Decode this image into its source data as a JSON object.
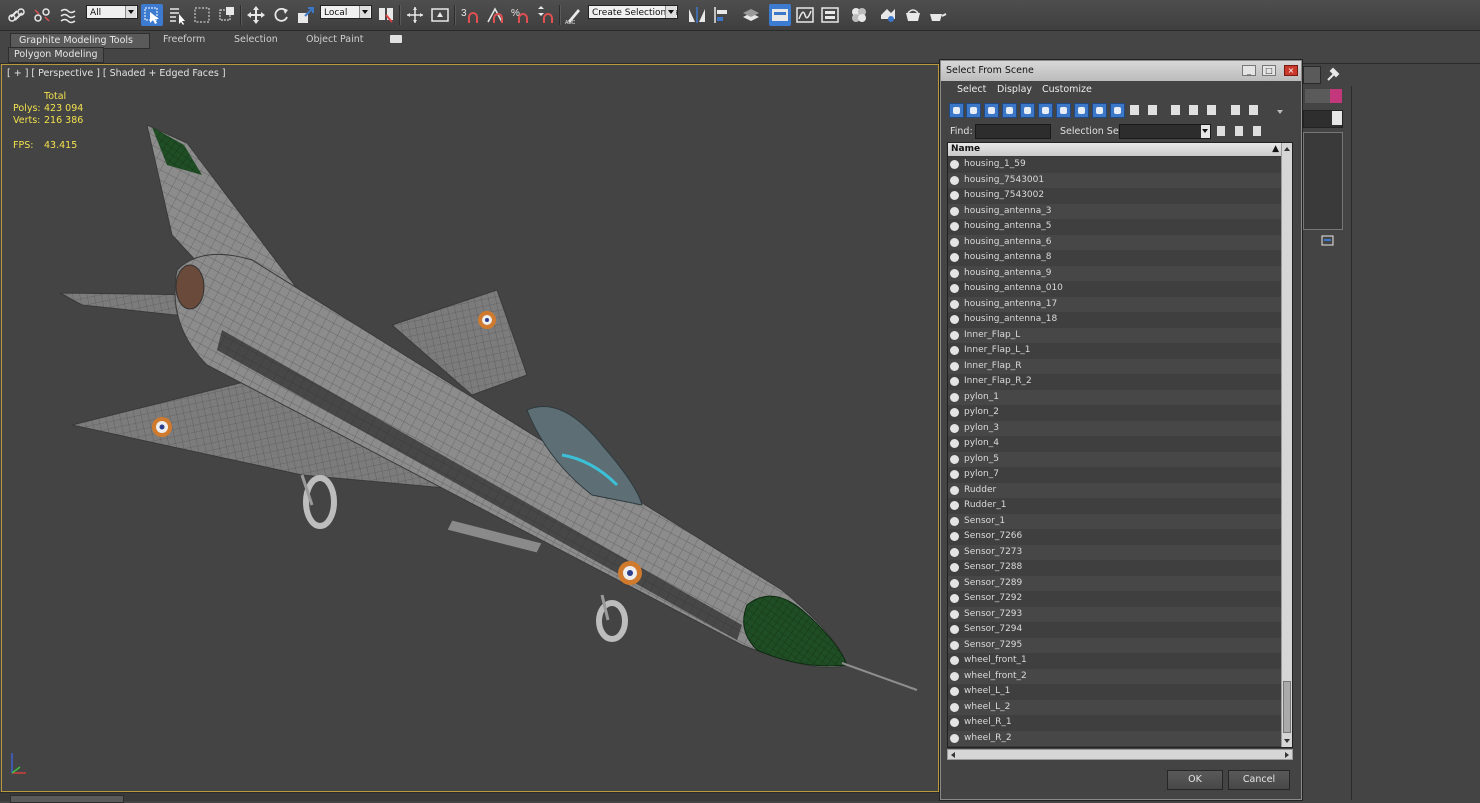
{
  "toolbar": {
    "filter_value": "All",
    "coord_system": "Local",
    "selection_set_placeholder": "Create Selection Se"
  },
  "ribbon": {
    "tabs": [
      "Graphite Modeling Tools",
      "Freeform",
      "Selection",
      "Object Paint"
    ],
    "sub_tab": "Polygon Modeling"
  },
  "viewport": {
    "label": "[ + ] [ Perspective ] [ Shaded + Edged Faces ]",
    "stats": {
      "total_label": "Total",
      "polys_label": "Polys:",
      "polys_value": "423 094",
      "verts_label": "Verts:",
      "verts_value": "216 386",
      "fps_label": "FPS:",
      "fps_value": "43.415"
    }
  },
  "dialog": {
    "title": "Select From Scene",
    "menu": [
      "Select",
      "Display",
      "Customize"
    ],
    "find_label": "Find:",
    "selection_set_label": "Selection Set:",
    "column_name": "Name",
    "items": [
      "housing_1_59",
      "housing_7543001",
      "housing_7543002",
      "housing_antenna_3",
      "housing_antenna_5",
      "housing_antenna_6",
      "housing_antenna_8",
      "housing_antenna_9",
      "housing_antenna_010",
      "housing_antenna_17",
      "housing_antenna_18",
      "Inner_Flap_L",
      "Inner_Flap_L_1",
      "Inner_Flap_R",
      "Inner_Flap_R_2",
      "pylon_1",
      "pylon_2",
      "pylon_3",
      "pylon_4",
      "pylon_5",
      "pylon_7",
      "Rudder",
      "Rudder_1",
      "Sensor_1",
      "Sensor_7266",
      "Sensor_7273",
      "Sensor_7288",
      "Sensor_7289",
      "Sensor_7292",
      "Sensor_7293",
      "Sensor_7294",
      "Sensor_7295",
      "wheel_front_1",
      "wheel_front_2",
      "wheel_L_1",
      "wheel_L_2",
      "wheel_R_1",
      "wheel_R_2"
    ],
    "ok_label": "OK",
    "cancel_label": "Cancel"
  },
  "colors": {
    "viewport_bg": "#444444",
    "stats_text": "#f2e14d",
    "active_blue": "#3c77c8",
    "viewport_border": "#b89a3a"
  },
  "icons": [
    "link-icon",
    "unlink-icon",
    "bind-spacewarp-icon",
    "select-object-icon",
    "select-by-name-icon",
    "rect-region-icon",
    "window-crossing-icon",
    "move-icon",
    "rotate-icon",
    "scale-icon",
    "pivot-icon",
    "snap-3d-icon",
    "angle-snap-icon",
    "percent-snap-icon",
    "spinner-snap-icon",
    "edit-named-sets-icon",
    "mirror-icon",
    "align-icon",
    "layer-manager-icon",
    "graphite-icon",
    "curve-editor-icon",
    "schematic-icon",
    "material-editor-icon",
    "render-setup-icon",
    "rendered-frame-icon",
    "render-icon"
  ]
}
